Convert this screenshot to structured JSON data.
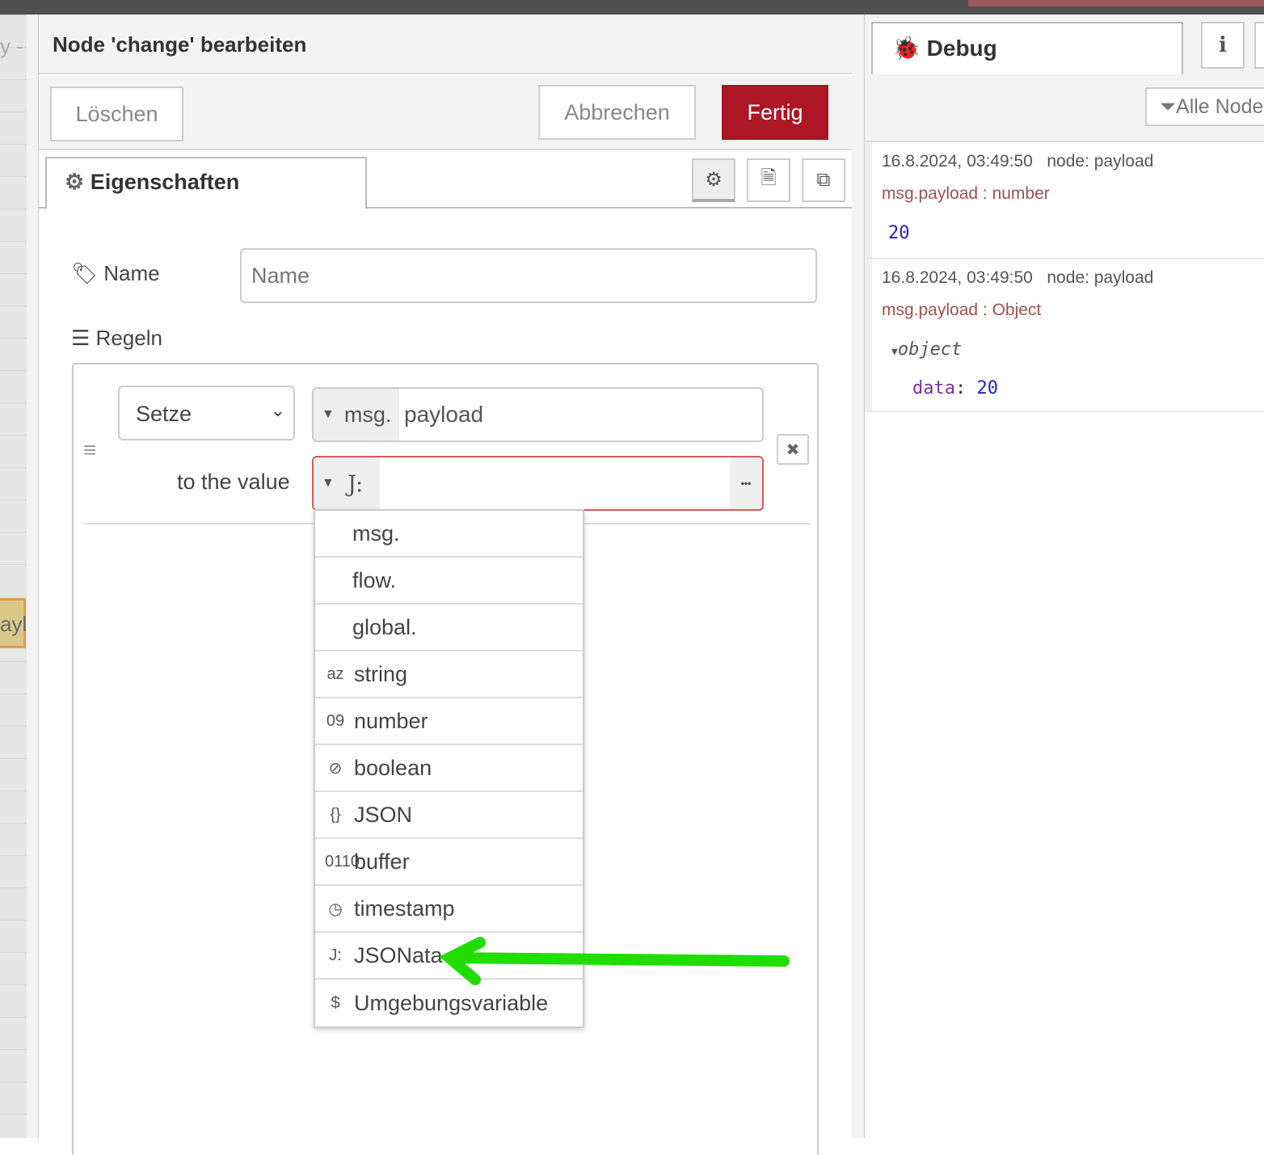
{
  "canvas": {
    "top_text": "y -",
    "node_label": "ayl"
  },
  "editor": {
    "title": "Node 'change' bearbeiten",
    "delete_label": "Löschen",
    "cancel_label": "Abbrechen",
    "done_label": "Fertig",
    "tab_properties": "Eigenschaften",
    "name_label": "Name",
    "name_placeholder": "Name",
    "rules_label": "Regeln",
    "rule": {
      "action": "Setze",
      "target_prefix": "msg.",
      "target_value": "payload",
      "value_label": "to the value",
      "value_type_icon": "J:",
      "more_label": "•••"
    },
    "dropdown": [
      {
        "icon": "",
        "label": "msg."
      },
      {
        "icon": "",
        "label": "flow."
      },
      {
        "icon": "",
        "label": "global."
      },
      {
        "icon": "az",
        "label": "string"
      },
      {
        "icon": "09",
        "label": "number"
      },
      {
        "icon": "⊘",
        "label": "boolean"
      },
      {
        "icon": "{}",
        "label": "JSON"
      },
      {
        "icon": "0110",
        "label": "buffer"
      },
      {
        "icon": "◷",
        "label": "timestamp"
      },
      {
        "icon": "J:",
        "label": "JSONata"
      },
      {
        "icon": "$",
        "label": "Umgebungsvariable"
      }
    ]
  },
  "sidebar": {
    "tab_debug": "Debug",
    "info_icon": "i",
    "filter_label": "Alle Nodes",
    "messages": [
      {
        "time": "16.8.2024, 03:49:50",
        "node": "node: payload",
        "path": "msg.payload : number",
        "value": "20"
      },
      {
        "time": "16.8.2024, 03:49:50",
        "node": "node: payload",
        "path": "msg.payload : Object",
        "object_label": "object",
        "key": "data",
        "value": "20"
      }
    ]
  },
  "annotation": {
    "arrow_color": "#22dd00"
  },
  "colors": {
    "primary": "#ad1625",
    "error_border": "#d65a5a",
    "debug_path": "#a05050"
  }
}
